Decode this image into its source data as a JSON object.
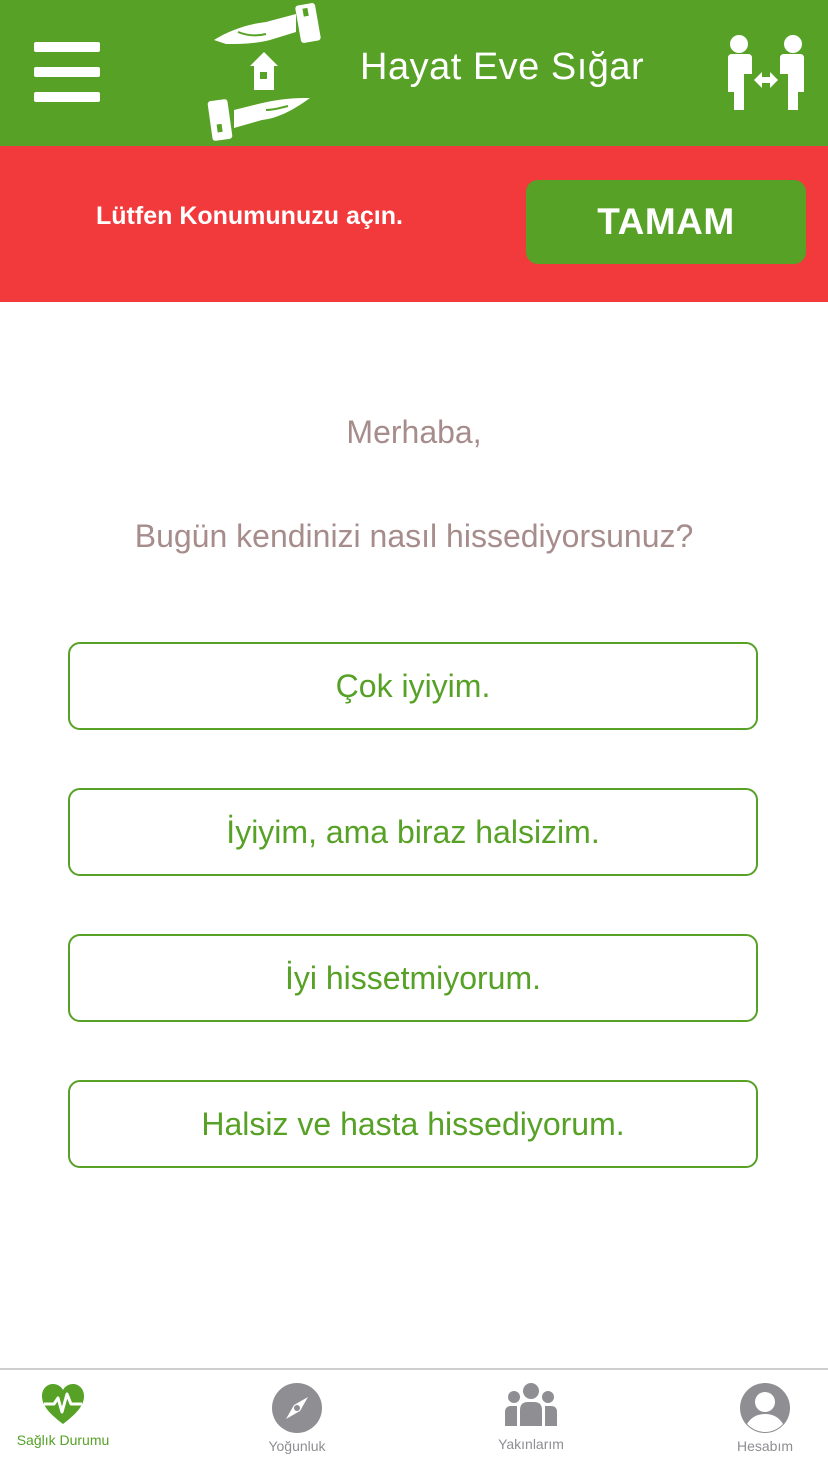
{
  "header": {
    "title": "Hayat Eve Sığar",
    "menu_icon": "menu-icon",
    "logo_icon": "hands-house-logo",
    "right_icon": "social-distance-icon"
  },
  "alert": {
    "message": "Lütfen Konumunuzu açın.",
    "button_label": "TAMAM",
    "background_color": "#f2393c"
  },
  "main": {
    "greeting": "Merhaba,",
    "question": "Bugün kendinizi nasıl hissediyorsunuz?",
    "options": [
      "Çok iyiyim.",
      "İyiyim, ama biraz halsizim.",
      "İyi hissetmiyorum.",
      "Halsiz ve hasta hissediyorum."
    ]
  },
  "bottom_nav": {
    "items": [
      {
        "label": "Sağlık Durumu",
        "icon": "heart-pulse-icon",
        "active": true
      },
      {
        "label": "Yoğunluk",
        "icon": "compass-icon",
        "active": false
      },
      {
        "label": "Yakınlarım",
        "icon": "people-icon",
        "active": false
      },
      {
        "label": "Hesabım",
        "icon": "account-icon",
        "active": false
      }
    ]
  },
  "colors": {
    "brand_green": "#56a126",
    "alert_red": "#f2393c",
    "muted_text": "#a78c8c",
    "nav_gray": "#8e8e93"
  }
}
